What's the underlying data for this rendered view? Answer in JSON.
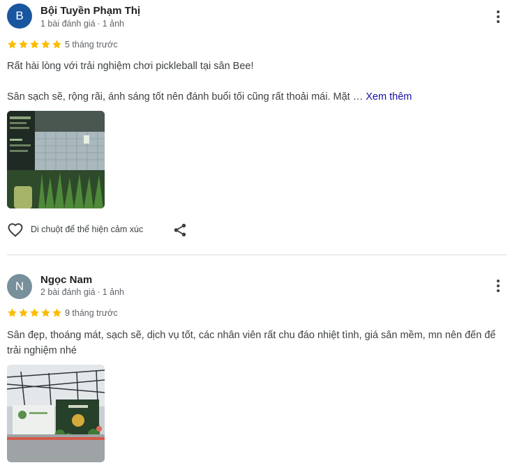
{
  "reviews": [
    {
      "avatar_letter": "B",
      "avatar_color": "#1a56a0",
      "name": "Bội Tuyền Phạm Thị",
      "review_count": "1 bài đánh giá",
      "photo_count": "1 ảnh",
      "rating": 5,
      "time_ago": "5 tháng trước",
      "text_line1": "Rất hài lòng với trải nghiệm chơi pickleball tại sân Bee!",
      "text_line2": "Sân sạch sẽ, rộng rãi, ánh sáng tốt nên đánh buổi tối cũng rất thoải mái. Mặt …",
      "more_label": "Xem thêm",
      "react_label": "Di chuột để thể hiện cảm xúc"
    },
    {
      "avatar_letter": "N",
      "avatar_color": "#78909c",
      "name": "Ngọc Nam",
      "review_count": "2 bài đánh giá",
      "photo_count": "1 ảnh",
      "rating": 5,
      "time_ago": "9 tháng trước",
      "text": "Sân đẹp, thoáng mát, sạch sẽ, dịch vụ tốt, các nhân viên rất chu đáo nhiệt tình, giá sân mềm, mn nên đến để trải nghiệm nhé"
    }
  ],
  "colors": {
    "star": "#fbbc04",
    "link": "#1a0dab"
  },
  "icons": {
    "menu": "more-vert-icon",
    "like": "heart-outline-icon",
    "share": "share-icon",
    "star": "star-icon"
  }
}
